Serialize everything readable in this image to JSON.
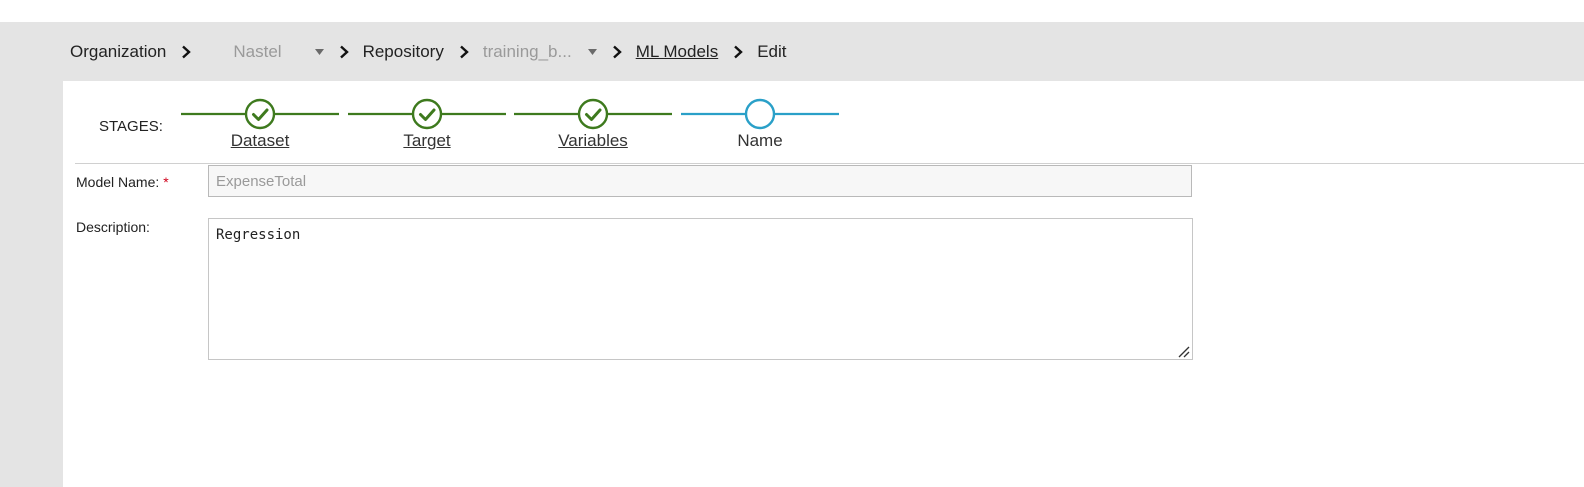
{
  "breadcrumb": {
    "organization": "Organization",
    "org_value": "Nastel",
    "repository": "Repository",
    "repo_value": "training_b...",
    "ml_models": "ML Models",
    "edit": "Edit"
  },
  "stages": {
    "label": "STAGES:",
    "items": [
      {
        "label": "Dataset",
        "state": "complete"
      },
      {
        "label": "Target",
        "state": "complete"
      },
      {
        "label": "Variables",
        "state": "complete"
      },
      {
        "label": "Name",
        "state": "current"
      }
    ],
    "colors": {
      "complete": "#3e7a1e",
      "current": "#2aa0c8"
    }
  },
  "form": {
    "model_name_label": "Model Name:",
    "required_mark": "*",
    "model_name_value": "ExpenseTotal",
    "description_label": "Description:",
    "description_value": "Regression"
  },
  "icons": {
    "separator": "chevron-right-icon",
    "dropdown": "caret-down-icon",
    "stage_done": "check-circle-icon",
    "stage_current": "empty-circle-icon",
    "resize": "resize-grip-icon"
  }
}
